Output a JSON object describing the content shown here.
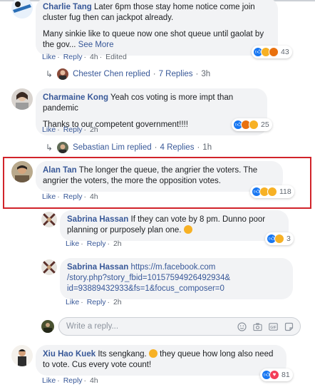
{
  "comments": [
    {
      "author": "Charlie Tang",
      "paragraphs": [
        "Later 6pm those stay home notice come join cluster fug then can jackpot already.",
        "Many sinkie like to queue now one shot queue until gaolat by the gov... "
      ],
      "see_more": "See More",
      "actions": {
        "like": "Like",
        "reply": "Reply",
        "time": "4h",
        "edited": "Edited"
      },
      "reaction_count": "43",
      "replies_line": {
        "who": "Chester Chen replied",
        "count": "7 Replies",
        "time": "3h"
      }
    },
    {
      "author": "Charmaine Kong",
      "paragraphs": [
        "Yeah cos voting is more impt than pandemic",
        "Thanks to our competent government!!!!"
      ],
      "actions": {
        "like": "Like",
        "reply": "Reply",
        "time": "2h"
      },
      "reaction_count": "25",
      "replies_line": {
        "who": "Sebastian Lim replied",
        "count": "4 Replies",
        "time": "1h"
      }
    },
    {
      "author": "Alan Tan",
      "paragraphs": [
        "The longer the queue, the angrier the voters. The angrier the voters, the more the opposition votes."
      ],
      "actions": {
        "like": "Like",
        "reply": "Reply",
        "time": "4h"
      },
      "reaction_count": "118",
      "highlight_color": "#d1232a"
    },
    {
      "author": "Sabrina Hassan",
      "paragraphs": [
        "If they can vote by 8 pm. Dunno poor planning or purposely plan one."
      ],
      "actions": {
        "like": "Like",
        "reply": "Reply",
        "time": "2h"
      },
      "reaction_count": "3"
    },
    {
      "author": "Sabrina Hassan",
      "link": "https://m.facebook.com/story.php?story_fbid=10157594926492934&id=93889432933&fs=1&focus_composer=0",
      "link_lines": [
        "https://m.facebook.com",
        "/story.php?story_fbid=10157594926492934&",
        "id=93889432933&fs=1&focus_composer=0"
      ],
      "actions": {
        "like": "Like",
        "reply": "Reply",
        "time": "2h"
      }
    },
    {
      "author": "Xiu Hao Kuek",
      "paragraphs": [
        "Its sengkang.",
        "they queue how long also need to vote. Cus every vote count!"
      ],
      "actions": {
        "like": "Like",
        "reply": "Reply",
        "time": "4h"
      },
      "reaction_count": "81"
    }
  ],
  "composer": {
    "placeholder": "Write a reply..."
  },
  "colors": {
    "link": "#385898",
    "bubble": "#f2f3f5",
    "highlight": "#d1232a",
    "like": "#1877f2"
  }
}
